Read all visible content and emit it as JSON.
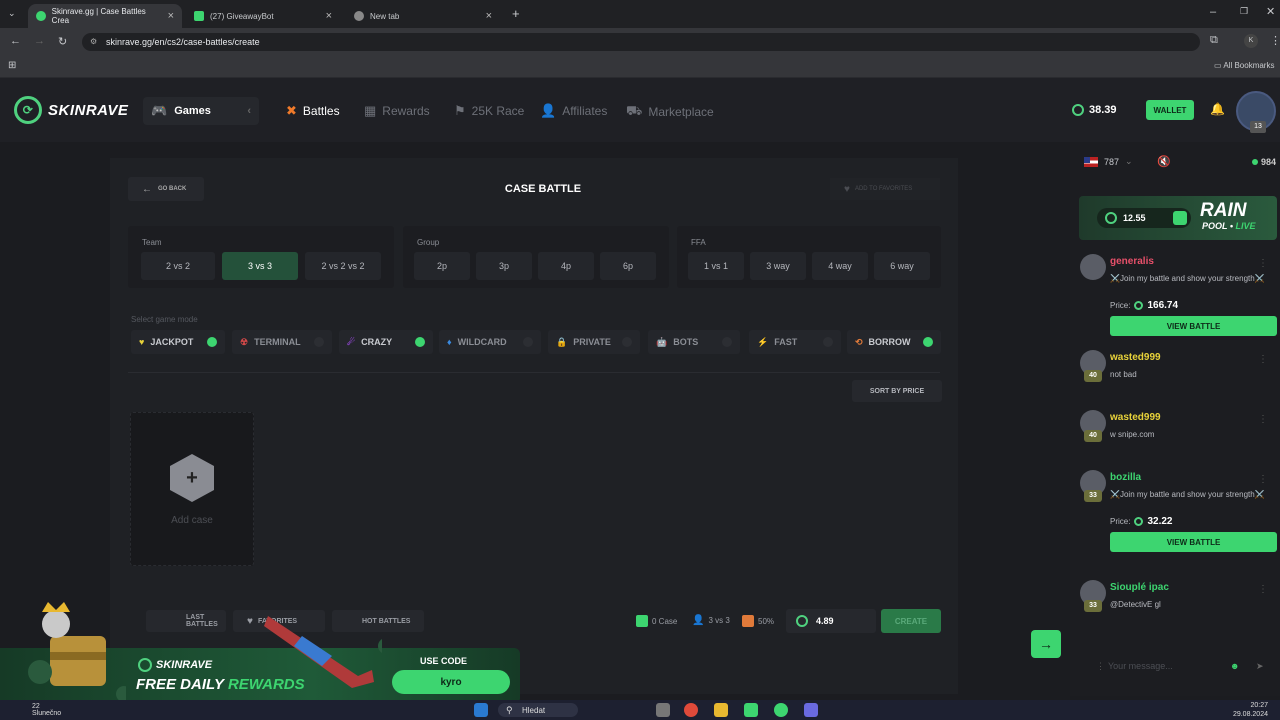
{
  "browser": {
    "tabs": [
      {
        "title": "Skinrave.gg | Case Battles Crea"
      },
      {
        "title": "(27) GiveawayBot"
      },
      {
        "title": "New tab"
      }
    ],
    "url": "skinrave.gg/en/cs2/case-battles/create",
    "profile_initial": "K",
    "bookmarks_label": "All Bookmarks"
  },
  "header": {
    "logo_text": "SKINRAVE",
    "games_label": "Games",
    "nav": [
      {
        "label": "Battles"
      },
      {
        "label": "Rewards"
      },
      {
        "label": "25K Race"
      },
      {
        "label": "Affiliates"
      },
      {
        "label": "Marketplace"
      }
    ],
    "balance": "38.39",
    "wallet_label": "WALLET",
    "user_level": "13"
  },
  "battle": {
    "back_label": "GO BACK",
    "title": "CASE BATTLE",
    "favorites_label": "ADD TO FAVORITES",
    "team": {
      "label": "Team",
      "options": [
        "2 vs 2",
        "3 vs 3",
        "2 vs 2 vs 2"
      ],
      "selected": "3 vs 3"
    },
    "group": {
      "label": "Group",
      "options": [
        "2p",
        "3p",
        "4p",
        "6p"
      ]
    },
    "ffa": {
      "label": "FFA",
      "options": [
        "1 vs 1",
        "3 way",
        "4 way",
        "6 way"
      ]
    },
    "mode_label": "Select game mode",
    "modes": [
      {
        "label": "JACKPOT",
        "on": true,
        "color": "#e8d23a"
      },
      {
        "label": "TERMINAL",
        "on": false,
        "color": "#d04848"
      },
      {
        "label": "CRAZY",
        "on": true,
        "color": "#9a4ae0"
      },
      {
        "label": "WILDCARD",
        "on": false,
        "color": "#3a8ae0"
      },
      {
        "label": "PRIVATE",
        "on": false,
        "color": "#3dd570"
      },
      {
        "label": "BOTS",
        "on": false,
        "color": "#3dd5b0"
      },
      {
        "label": "FAST",
        "on": false,
        "color": "#7a7ae0"
      },
      {
        "label": "BORROW",
        "on": true,
        "color": "#e07a3a"
      }
    ],
    "sort_label": "SORT BY PRICE",
    "add_case_label": "Add case",
    "bottom": {
      "last_battles": "LAST BATTLES",
      "favorites": "FAVORITES",
      "hot_battles": "HOT BATTLES",
      "case_count": "0 Case",
      "team_mode": "3 vs 3",
      "borrow_pct": "50%",
      "cost": "4.89",
      "create_label": "CREATE"
    }
  },
  "sidebar": {
    "online_flag_count": "787",
    "online_count": "984",
    "rain": {
      "amount": "12.55",
      "title": "RAIN",
      "pool": "POOL",
      "live": "LIVE"
    },
    "messages": [
      {
        "name": "generalis",
        "text": "⚔️Join my battle and show your strength⚔️",
        "price_label": "Price:",
        "price": "166.74",
        "button": "VIEW BATTLE",
        "level": "",
        "name_color": "#e8506a"
      },
      {
        "name": "wasted999",
        "text": "not bad",
        "level": "40",
        "name_color": "#e8d23a"
      },
      {
        "name": "wasted999",
        "text": "w snipe.com",
        "level": "40",
        "name_color": "#e8d23a"
      },
      {
        "name": "bozilla",
        "text": "⚔️Join my battle and show your strength⚔️",
        "price_label": "Price:",
        "price": "32.22",
        "button": "VIEW BATTLE",
        "level": "33",
        "name_color": "#3dd570"
      },
      {
        "name": "Siouplé ipac",
        "text": "@DetectivE gl",
        "level": "33",
        "name_color": "#3dd570"
      }
    ],
    "input_placeholder": "Your message..."
  },
  "promo": {
    "brand": "SKINRAVE",
    "headline_a": "FREE DAILY",
    "headline_b": "REWARDS",
    "use_code": "USE CODE",
    "code": "kyro"
  },
  "taskbar": {
    "weather": "Slunečno",
    "temp": "22",
    "search": "Hledat",
    "time": "20:27",
    "date": "29.08.2024"
  }
}
